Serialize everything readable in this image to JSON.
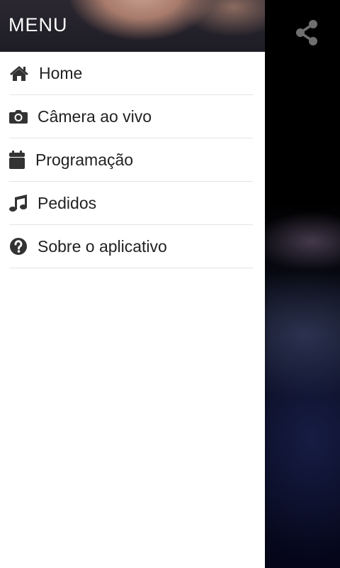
{
  "drawer": {
    "title": "MENU",
    "items": [
      {
        "label": "Home",
        "icon": "home-icon"
      },
      {
        "label": "Câmera ao vivo",
        "icon": "camera-icon"
      },
      {
        "label": "Programação",
        "icon": "calendar-icon"
      },
      {
        "label": "Pedidos",
        "icon": "music-icon"
      },
      {
        "label": "Sobre o aplicativo",
        "icon": "question-circle-icon"
      }
    ]
  },
  "toolbar": {
    "share_icon": "share-icon"
  },
  "colors": {
    "drawer_bg": "#ffffff",
    "text": "#222222",
    "divider": "#e4e4e4",
    "icon": "#333333"
  }
}
